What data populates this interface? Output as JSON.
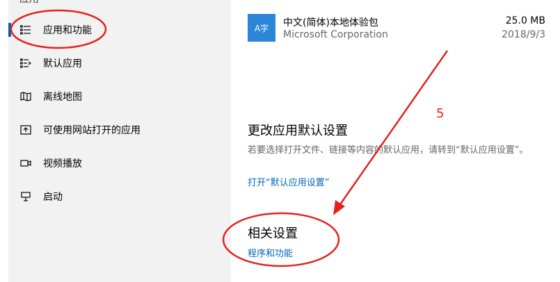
{
  "sidebar": {
    "header": "应用",
    "items": [
      {
        "label": "应用和功能",
        "icon": "apps-features-icon",
        "active": true
      },
      {
        "label": "默认应用",
        "icon": "default-apps-icon",
        "active": false
      },
      {
        "label": "离线地图",
        "icon": "offline-maps-icon",
        "active": false
      },
      {
        "label": "可使用网站打开的应用",
        "icon": "apps-for-websites-icon",
        "active": false
      },
      {
        "label": "视频播放",
        "icon": "video-playback-icon",
        "active": false
      },
      {
        "label": "启动",
        "icon": "startup-icon",
        "active": false
      }
    ]
  },
  "main": {
    "app": {
      "tile_text": "A字",
      "name": "中文(简体)本地体验包",
      "publisher": "Microsoft Corporation",
      "size": "25.0 MB",
      "date": "2018/9/3"
    },
    "defaults_section": {
      "title": "更改应用默认设置",
      "description": "若要选择打开文件、链接等内容的默认应用，请转到“默认应用设置”。",
      "link": "打开“默认应用设置”"
    },
    "related_section": {
      "title": "相关设置",
      "link": "程序和功能"
    }
  },
  "annotations": {
    "number": "5",
    "color": "#e52020"
  }
}
